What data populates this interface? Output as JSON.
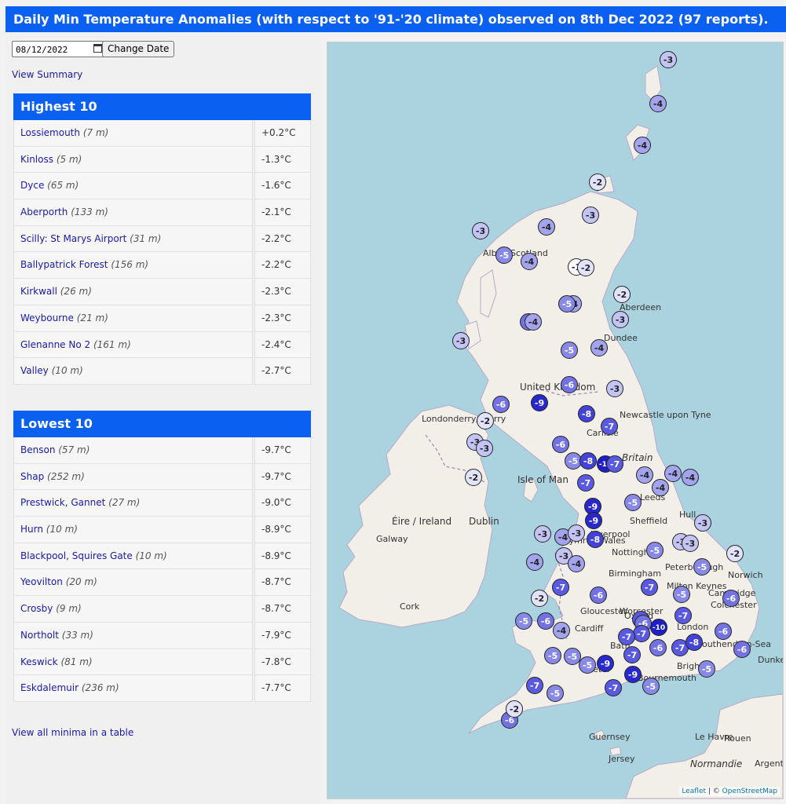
{
  "header": {
    "title": "Daily Min Temperature Anomalies (with respect to '91-'20 climate) observed on 8th Dec 2022 (97 reports)."
  },
  "controls": {
    "date_value": "08/12/2022",
    "change_label": "Change Date",
    "summary_link": "View Summary",
    "all_link": "View all minima in a table"
  },
  "highest": {
    "title": "Highest 10",
    "rows": [
      {
        "name": "Lossiemouth",
        "elev": "(7 m)",
        "val": "+0.2°C"
      },
      {
        "name": "Kinloss",
        "elev": "(5 m)",
        "val": "-1.3°C"
      },
      {
        "name": "Dyce",
        "elev": "(65 m)",
        "val": "-1.6°C"
      },
      {
        "name": "Aberporth",
        "elev": "(133 m)",
        "val": "-2.1°C"
      },
      {
        "name": "Scilly: St Marys Airport",
        "elev": "(31 m)",
        "val": "-2.2°C"
      },
      {
        "name": "Ballypatrick Forest",
        "elev": "(156 m)",
        "val": "-2.2°C"
      },
      {
        "name": "Kirkwall",
        "elev": "(26 m)",
        "val": "-2.3°C"
      },
      {
        "name": "Weybourne",
        "elev": "(21 m)",
        "val": "-2.3°C"
      },
      {
        "name": "Glenanne No 2",
        "elev": "(161 m)",
        "val": "-2.4°C"
      },
      {
        "name": "Valley",
        "elev": "(10 m)",
        "val": "-2.7°C"
      }
    ]
  },
  "lowest": {
    "title": "Lowest 10",
    "rows": [
      {
        "name": "Benson",
        "elev": "(57 m)",
        "val": "-9.7°C"
      },
      {
        "name": "Shap",
        "elev": "(252 m)",
        "val": "-9.7°C"
      },
      {
        "name": "Prestwick, Gannet",
        "elev": "(27 m)",
        "val": "-9.0°C"
      },
      {
        "name": "Hurn",
        "elev": "(10 m)",
        "val": "-8.9°C"
      },
      {
        "name": "Blackpool, Squires Gate",
        "elev": "(10 m)",
        "val": "-8.9°C"
      },
      {
        "name": "Yeovilton",
        "elev": "(20 m)",
        "val": "-8.7°C"
      },
      {
        "name": "Crosby",
        "elev": "(9 m)",
        "val": "-8.7°C"
      },
      {
        "name": "Northolt",
        "elev": "(33 m)",
        "val": "-7.9°C"
      },
      {
        "name": "Keswick",
        "elev": "(81 m)",
        "val": "-7.8°C"
      },
      {
        "name": "Eskdalemuir",
        "elev": "(236 m)",
        "val": "-7.7°C"
      }
    ]
  },
  "map": {
    "places": [
      {
        "t": "United Kingdom",
        "c": "big"
      },
      {
        "t": "Britain",
        "c": "it"
      },
      {
        "t": "Éire / Ireland",
        "c": "big"
      },
      {
        "t": "Isle of Man",
        "c": "big"
      },
      {
        "t": "Dublin",
        "c": "big"
      },
      {
        "t": "Galway"
      },
      {
        "t": "Cork"
      },
      {
        "t": "Londonderry/ Derry"
      },
      {
        "t": "Aberdeen"
      },
      {
        "t": "Dundee"
      },
      {
        "t": "Newcastle upon Tyne"
      },
      {
        "t": "Carlisle"
      },
      {
        "t": "Leeds"
      },
      {
        "t": "Sheffield"
      },
      {
        "t": "Hull"
      },
      {
        "t": "Nottingham"
      },
      {
        "t": "Birmingham"
      },
      {
        "t": "Peterborough"
      },
      {
        "t": "Norwich"
      },
      {
        "t": "Cambridge"
      },
      {
        "t": "Colchester"
      },
      {
        "t": "Worcester"
      },
      {
        "t": "Gloucester"
      },
      {
        "t": "Oxford"
      },
      {
        "t": "London"
      },
      {
        "t": "Cardiff"
      },
      {
        "t": "Bath"
      },
      {
        "t": "Exeter"
      },
      {
        "t": "Bournemouth"
      },
      {
        "t": "Brighton"
      },
      {
        "t": "Southend-on-Sea"
      },
      {
        "t": "Dunkerque"
      },
      {
        "t": "Guernsey"
      },
      {
        "t": "Jersey"
      },
      {
        "t": "Le Havre"
      },
      {
        "t": "Rouen"
      },
      {
        "t": "Normandie",
        "c": "it"
      },
      {
        "t": "Argentan"
      },
      {
        "t": "Alba / Scotland"
      },
      {
        "t": "Cymru / Wales"
      },
      {
        "t": "Milton Keynes"
      },
      {
        "t": "Liverpool"
      }
    ],
    "markers": [
      "-3",
      "-4",
      "-4",
      "-2",
      "-3",
      "-3",
      "-4",
      "-5",
      "-4",
      "-1",
      "-2",
      "-4",
      "-5",
      "-2",
      "-3",
      "-6",
      "-4",
      "-5",
      "-4",
      "-3",
      "-6",
      "-9",
      "-6",
      "-3",
      "-8",
      "-2",
      "-7",
      "-3",
      "-3",
      "-4",
      "-6",
      "-5",
      "-8",
      "-10",
      "-7",
      "-2",
      "-7",
      "-4",
      "-4",
      "-4",
      "-9",
      "-5",
      "-9",
      "-3",
      "-3",
      "-8",
      "-4",
      "-3",
      "-3",
      "-3",
      "-5",
      "-3",
      "-4",
      "-4",
      "-5",
      "-2",
      "-7",
      "-6",
      "-7",
      "-5",
      "-2",
      "-6",
      "-5",
      "-6",
      "-4",
      "-7",
      "-7",
      "-10",
      "-6",
      "-7",
      "-7",
      "-7",
      "-8",
      "-6",
      "-6",
      "-5",
      "-5",
      "-6",
      "-5",
      "-9",
      "-7",
      "-9",
      "-5",
      "-7",
      "-5",
      "-7",
      "-5",
      "-6",
      "-2"
    ],
    "attribution_leaflet": "Leaflet",
    "attribution_sep": " | © ",
    "attribution_osm": "OpenStreetMap"
  }
}
